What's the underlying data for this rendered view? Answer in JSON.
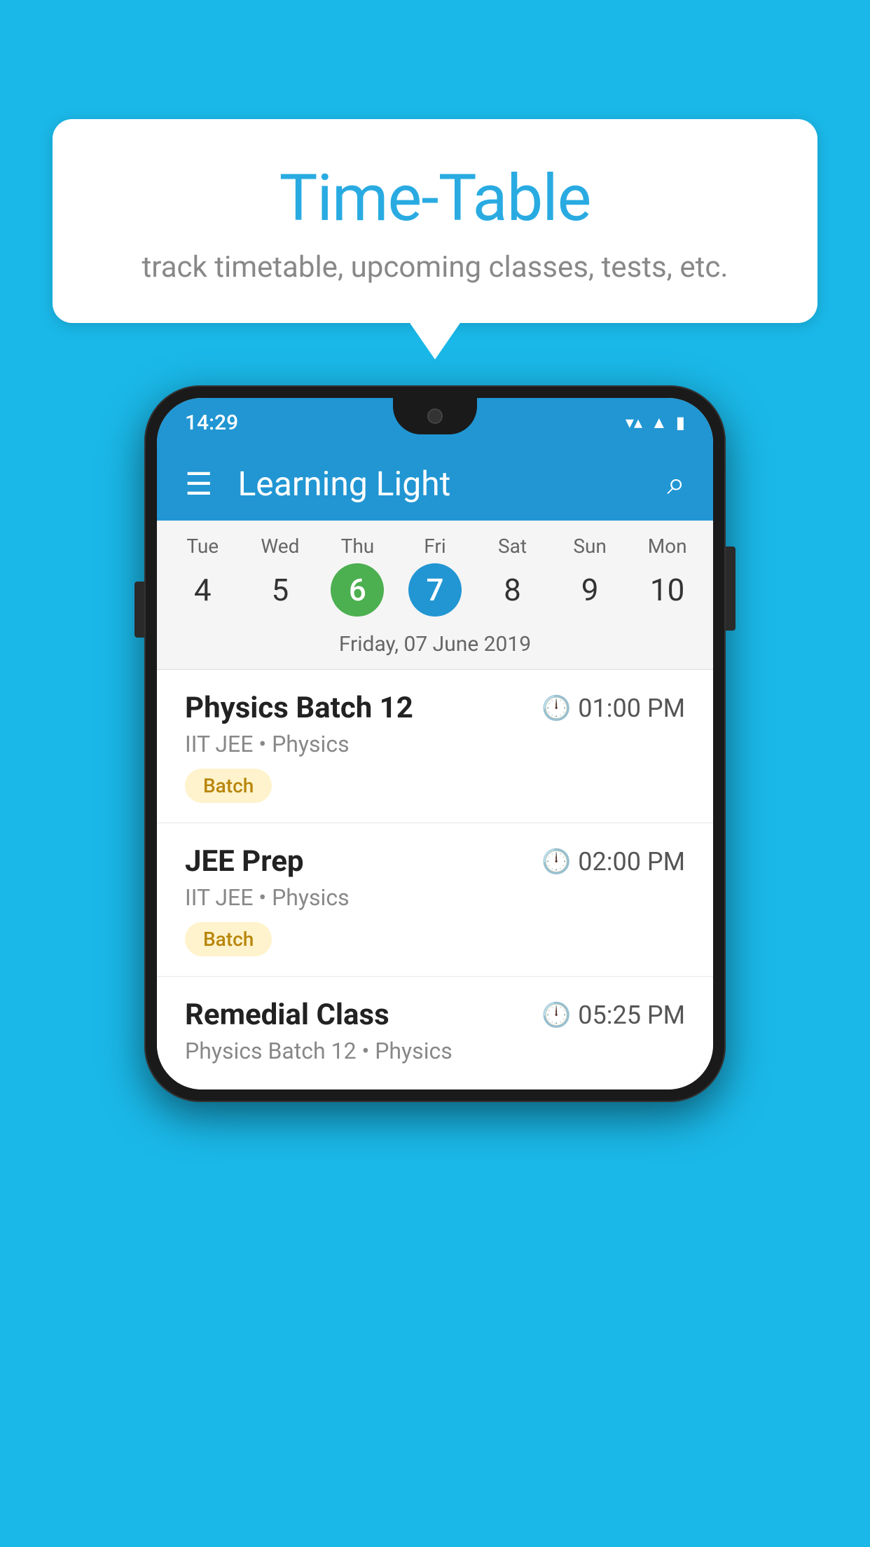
{
  "background": {
    "color": "#1ab8e8"
  },
  "speech_bubble": {
    "title": "Time-Table",
    "subtitle": "track timetable, upcoming classes, tests, etc."
  },
  "phone": {
    "status_bar": {
      "time": "14:29",
      "wifi_icon": "wifi",
      "signal_icon": "signal",
      "battery_icon": "battery"
    },
    "app_header": {
      "menu_icon": "menu",
      "title": "Learning Light",
      "search_icon": "search"
    },
    "calendar": {
      "days": [
        {
          "name": "Tue",
          "num": "4",
          "state": "normal"
        },
        {
          "name": "Wed",
          "num": "5",
          "state": "normal"
        },
        {
          "name": "Thu",
          "num": "6",
          "state": "today"
        },
        {
          "name": "Fri",
          "num": "7",
          "state": "selected"
        },
        {
          "name": "Sat",
          "num": "8",
          "state": "normal"
        },
        {
          "name": "Sun",
          "num": "9",
          "state": "normal"
        },
        {
          "name": "Mon",
          "num": "10",
          "state": "normal"
        }
      ],
      "selected_date_label": "Friday, 07 June 2019"
    },
    "schedule_items": [
      {
        "title": "Physics Batch 12",
        "time": "01:00 PM",
        "subtitle": "IIT JEE • Physics",
        "badge": "Batch"
      },
      {
        "title": "JEE Prep",
        "time": "02:00 PM",
        "subtitle": "IIT JEE • Physics",
        "badge": "Batch"
      },
      {
        "title": "Remedial Class",
        "time": "05:25 PM",
        "subtitle": "Physics Batch 12 • Physics",
        "badge": null
      }
    ]
  }
}
